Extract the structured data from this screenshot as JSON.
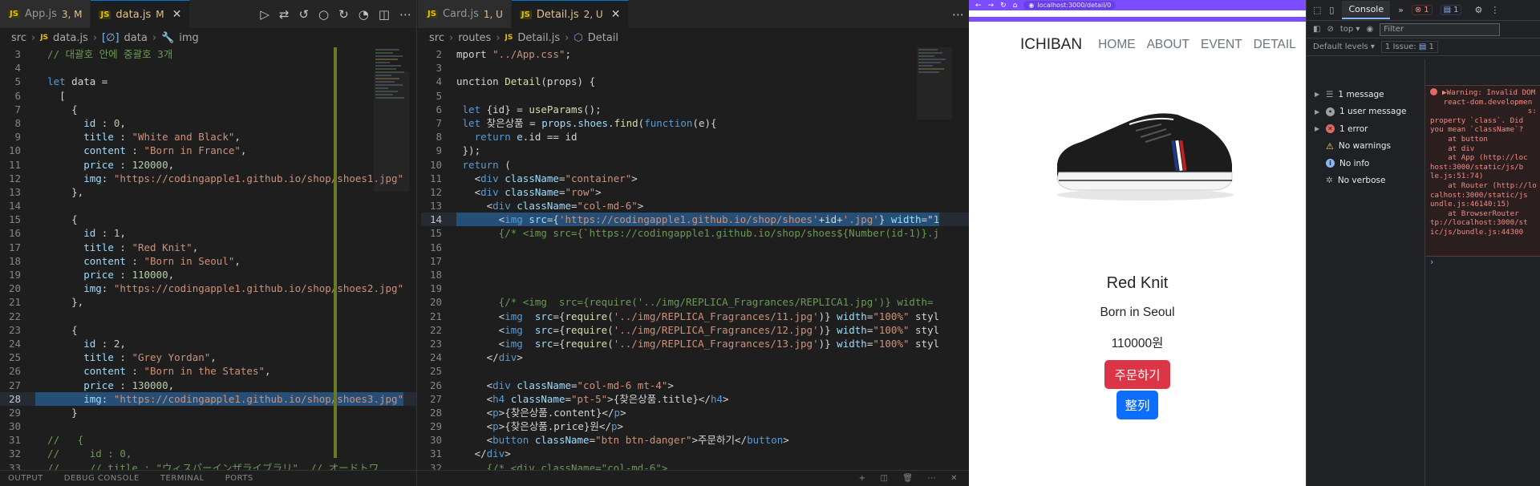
{
  "left_editor": {
    "tabs": [
      {
        "name": "App.js",
        "status": "3, M",
        "badge": "JS",
        "active": false
      },
      {
        "name": "data.js",
        "status": "M",
        "badge": "JS",
        "active": true
      }
    ],
    "breadcrumb": [
      "src",
      "data.js",
      "data",
      "img"
    ],
    "lines": [
      {
        "n": "3",
        "text": "  // 대괄호 안에 중괄호 3개"
      },
      {
        "n": "4",
        "text": ""
      },
      {
        "n": "5",
        "text": "  let data ="
      },
      {
        "n": "6",
        "text": "    ["
      },
      {
        "n": "7",
        "text": "      {"
      },
      {
        "n": "8",
        "text": "        id : 0,"
      },
      {
        "n": "9",
        "text": "        title : \"White and Black\","
      },
      {
        "n": "10",
        "text": "        content : \"Born in France\","
      },
      {
        "n": "11",
        "text": "        price : 120000,"
      },
      {
        "n": "12",
        "text": "        img: \"https://codingapple1.github.io/shop/shoes1.jpg\""
      },
      {
        "n": "13",
        "text": "      },"
      },
      {
        "n": "14",
        "text": ""
      },
      {
        "n": "15",
        "text": "      {"
      },
      {
        "n": "16",
        "text": "        id : 1,"
      },
      {
        "n": "17",
        "text": "        title : \"Red Knit\","
      },
      {
        "n": "18",
        "text": "        content : \"Born in Seoul\","
      },
      {
        "n": "19",
        "text": "        price : 110000,"
      },
      {
        "n": "20",
        "text": "        img: \"https://codingapple1.github.io/shop/shoes2.jpg\""
      },
      {
        "n": "21",
        "text": "      },"
      },
      {
        "n": "22",
        "text": ""
      },
      {
        "n": "23",
        "text": "      {"
      },
      {
        "n": "24",
        "text": "        id : 2,"
      },
      {
        "n": "25",
        "text": "        title : \"Grey Yordan\","
      },
      {
        "n": "26",
        "text": "        content : \"Born in the States\","
      },
      {
        "n": "27",
        "text": "        price : 130000,"
      },
      {
        "n": "28",
        "text": "        img: \"https://codingapple1.github.io/shop/shoes3.jpg\""
      },
      {
        "n": "29",
        "text": "      }"
      },
      {
        "n": "30",
        "text": ""
      },
      {
        "n": "31",
        "text": "  //   {"
      },
      {
        "n": "32",
        "text": "  //     id : 0,"
      },
      {
        "n": "33",
        "text": "  //     // title : \"ウィスパーインザライブラリ\", // オードトワ"
      }
    ]
  },
  "right_editor": {
    "tabs": [
      {
        "name": "Card.js",
        "status": "1, U",
        "badge": "JS",
        "active": false
      },
      {
        "name": "Detail.js",
        "status": "2, U",
        "badge": "JS",
        "active": true
      }
    ],
    "breadcrumb": [
      "src",
      "routes",
      "Detail.js",
      "Detail"
    ],
    "lines": [
      {
        "n": "2",
        "text": "mport \"../App.css\";"
      },
      {
        "n": "3",
        "text": ""
      },
      {
        "n": "4",
        "text": "unction Detail(props) {"
      },
      {
        "n": "5",
        "text": ""
      },
      {
        "n": "6",
        "text": " let {id} = useParams();"
      },
      {
        "n": "7",
        "text": " let 찾은상품 = props.shoes.find(function(e){"
      },
      {
        "n": "8",
        "text": "   return e.id == id"
      },
      {
        "n": "9",
        "text": " });"
      },
      {
        "n": "10",
        "text": " return ("
      },
      {
        "n": "11",
        "text": "   <div className=\"container\">"
      },
      {
        "n": "12",
        "text": "   <div className=\"row\">"
      },
      {
        "n": "13",
        "text": "     <div className=\"col-md-6\">"
      },
      {
        "n": "14",
        "text": "       <img src={'https://codingapple1.github.io/shop/shoes'+id+'.jpg'} width=\"1"
      },
      {
        "n": "15",
        "text": "       {/* <img src={`https://codingapple1.github.io/shop/shoes${Number(id-1)}.j"
      },
      {
        "n": "16",
        "text": ""
      },
      {
        "n": "17",
        "text": ""
      },
      {
        "n": "18",
        "text": ""
      },
      {
        "n": "19",
        "text": ""
      },
      {
        "n": "20",
        "text": "       {/* <img  src={require('../img/REPLICA_Fragrances/REPLICA1.jpg')} width="
      },
      {
        "n": "21",
        "text": "       <img  src={require('../img/REPLICA_Fragrances/11.jpg')} width=\"100%\" styl"
      },
      {
        "n": "22",
        "text": "       <img  src={require('../img/REPLICA_Fragrances/12.jpg')} width=\"100%\" styl"
      },
      {
        "n": "23",
        "text": "       <img  src={require('../img/REPLICA_Fragrances/13.jpg')} width=\"100%\" styl"
      },
      {
        "n": "24",
        "text": "     </div>"
      },
      {
        "n": "25",
        "text": ""
      },
      {
        "n": "26",
        "text": "     <div className=\"col-md-6 mt-4\">"
      },
      {
        "n": "27",
        "text": "     <h4 className=\"pt-5\">{찾은상품.title}</h4>"
      },
      {
        "n": "28",
        "text": "     <p>{찾은상품.content}</p>"
      },
      {
        "n": "29",
        "text": "     <p>{찾은상품.price}원</p>"
      },
      {
        "n": "30",
        "text": "     <button className=\"btn btn-danger\">주문하기</button>"
      },
      {
        "n": "31",
        "text": "   </div>"
      },
      {
        "n": "32",
        "text": "     {/* <div className=\"col-md-6\">"
      }
    ]
  },
  "statusbar": [
    "OUTPUT",
    "DEBUG CONSOLE",
    "TERMINAL",
    "PORTS"
  ],
  "browser": {
    "url": "localhost:3000/detail/0",
    "site": {
      "brand": "ICHIBAN",
      "nav": [
        "HOME",
        "ABOUT",
        "EVENT",
        "DETAIL"
      ],
      "product_title": "Red Knit",
      "product_content": "Born in Seoul",
      "product_price": "110000원",
      "order_button": "주문하기",
      "sort_button": "整列"
    }
  },
  "devtools": {
    "active_tab": "Console",
    "error_count": "1",
    "message_count": "1",
    "context": "top",
    "filter_placeholder": "Filter",
    "levels": "Default levels",
    "issues": "1 Issue:",
    "issues_count": "1",
    "sidebar": [
      {
        "label": "1 message",
        "icon": "list-icon",
        "color": "#9aa0a6"
      },
      {
        "label": "1 user message",
        "icon": "user-icon",
        "color": "#9aa0a6"
      },
      {
        "label": "1 error",
        "icon": "error-icon",
        "color": "#e46962"
      },
      {
        "label": "No warnings",
        "icon": "warning-icon",
        "color": "#fdd663"
      },
      {
        "label": "No info",
        "icon": "info-icon",
        "color": "#8ab4f8"
      },
      {
        "label": "No verbose",
        "icon": "verbose-icon",
        "color": "#9aa0a6"
      }
    ],
    "warning_lines": [
      "▶Warning: Invalid DOM",
      "   react-dom.developmen",
      "                      s:",
      "property `class`. Did",
      "you mean `className`?",
      "    at button",
      "    at div",
      "    at App (http://loc",
      "host:3000/static/js/b",
      "le.js:51:74)",
      "    at Router (http://lo",
      "calhost:3000/static/js",
      "undle.js:46140:15)",
      "    at BrowserRouter",
      "tp://localhost:3000/st",
      "ic/js/bundle.js:44300"
    ],
    "prompt": "›"
  }
}
